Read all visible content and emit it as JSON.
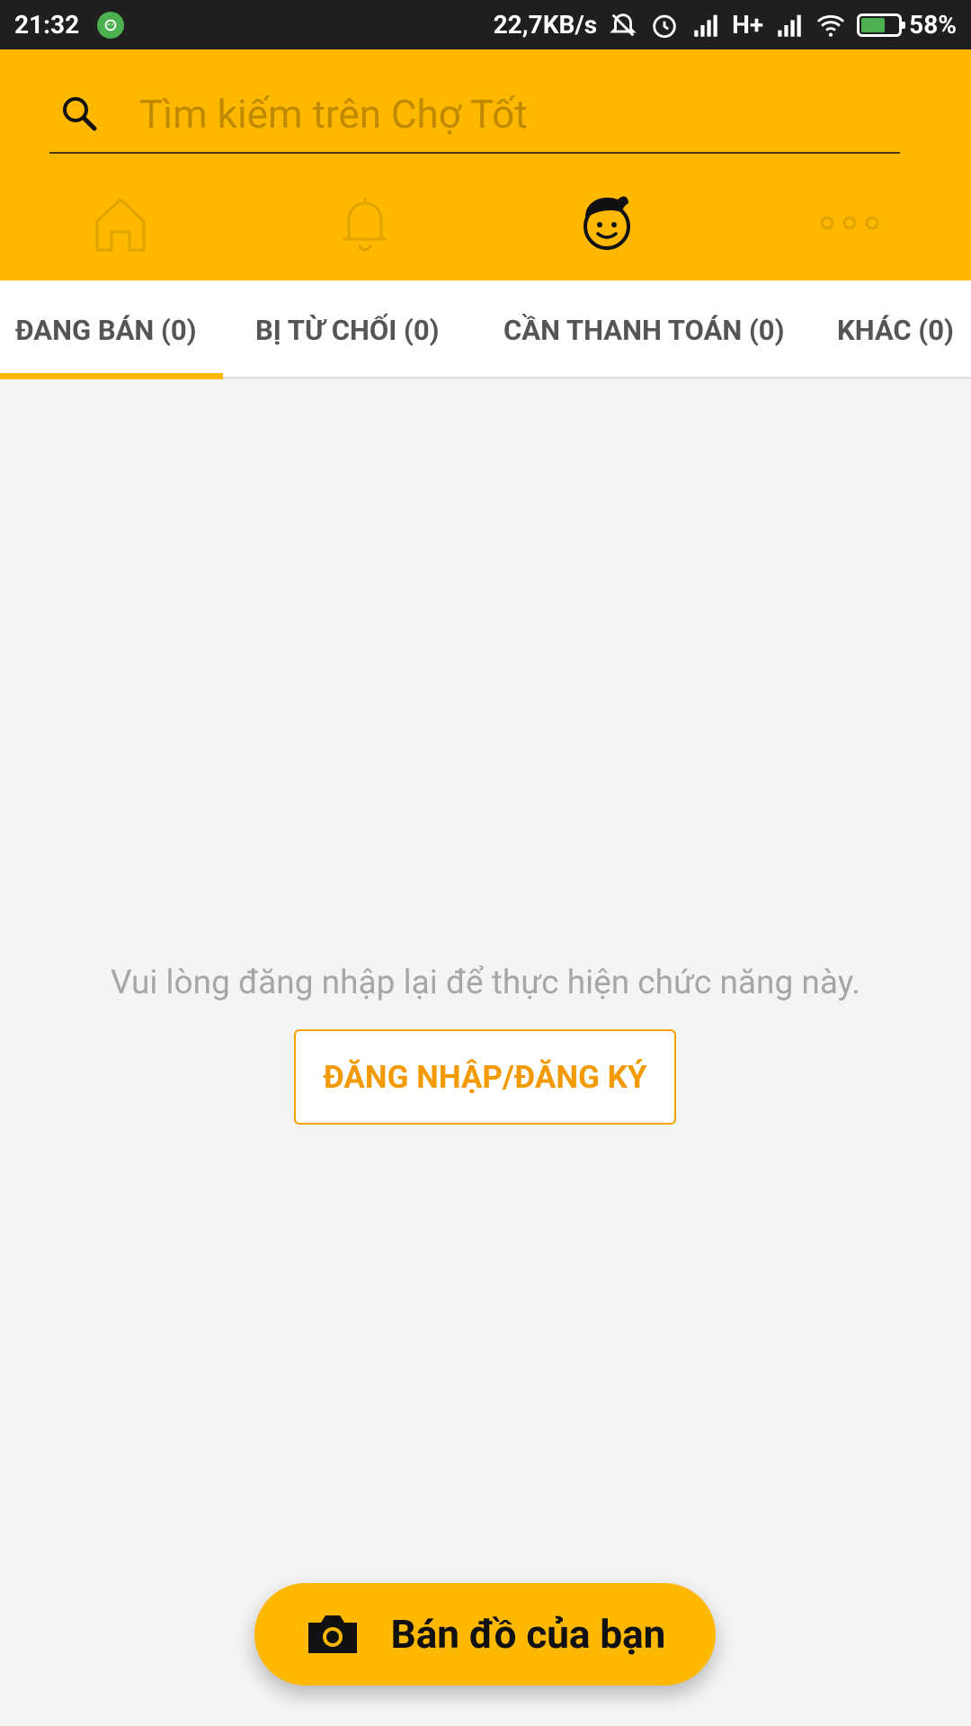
{
  "status_bar": {
    "time": "21:32",
    "network_speed": "22,7KB/s",
    "network_type": "H+",
    "battery_percent": "58%",
    "icons": [
      "notification-app-icon",
      "mute-icon",
      "alarm-icon",
      "signal-icon",
      "signal-icon",
      "wifi-icon",
      "battery-charging-icon"
    ]
  },
  "search": {
    "placeholder": "Tìm kiếm trên Chợ Tốt",
    "value": ""
  },
  "nav": {
    "items": [
      "home-icon",
      "bell-icon",
      "profile-face-icon",
      "more-dots-icon"
    ],
    "active": "profile-face-icon"
  },
  "tabs": {
    "items": [
      {
        "label": "ĐANG BÁN (0)"
      },
      {
        "label": "BỊ TỪ CHỐI (0)"
      },
      {
        "label": "CẦN THANH TOÁN (0)"
      },
      {
        "label": "KHÁC (0)"
      }
    ],
    "active_index": 0
  },
  "main": {
    "empty_message": "Vui lòng đăng nhập lại để thực hiện chức năng này.",
    "login_button": "ĐĂNG NHẬP/ĐĂNG KÝ"
  },
  "fab": {
    "label": "Bán đồ của bạn",
    "icon": "camera-icon"
  },
  "colors": {
    "accent": "#ffb800",
    "status_bar_bg": "#1f1f1f",
    "button_text": "#f29a00",
    "muted_text": "#a6a6a6"
  }
}
